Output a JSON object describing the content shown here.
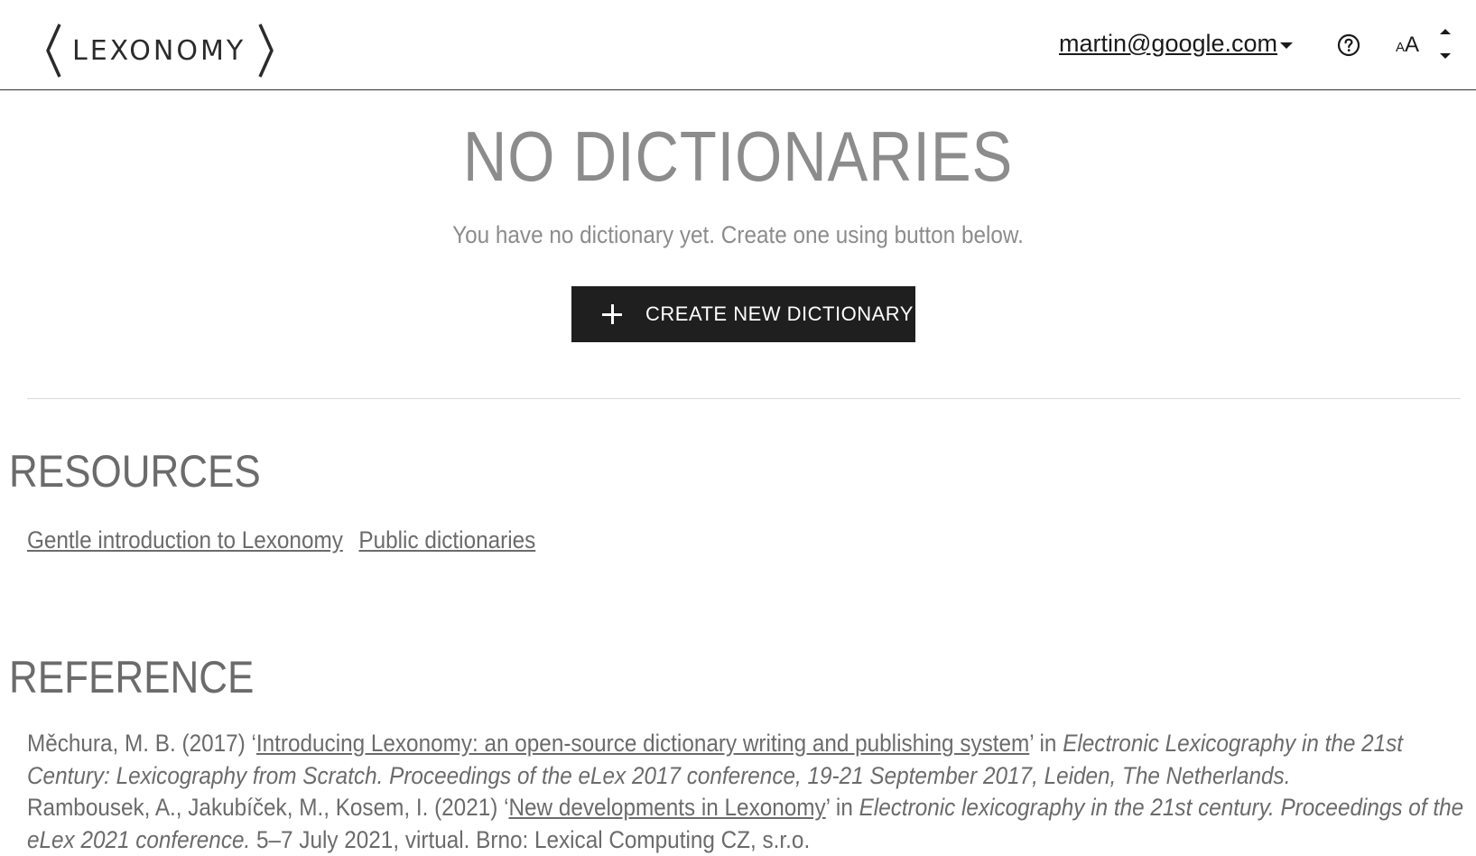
{
  "header": {
    "logo_text": "LEXONOMY",
    "user_email": "martin@google.com",
    "font_size_small": "A",
    "font_size_big": "A"
  },
  "empty_state": {
    "title": "NO DICTIONARIES",
    "subtitle": "You have no dictionary yet. Create one using button below.",
    "create_button_label": "CREATE NEW DICTIONARY"
  },
  "resources": {
    "title": "RESOURCES",
    "links": [
      "Gentle introduction to Lexonomy",
      "Public dictionaries"
    ]
  },
  "reference": {
    "title": "REFERENCE",
    "items": [
      {
        "authors": "Měchura, M. B. (2017) ‘",
        "link": "Introducing Lexonomy: an open-source dictionary writing and publishing system",
        "mid": "’ in ",
        "source": "Electronic Lexicography in the 21st Century: Lexicography from Scratch. Proceedings of the eLex 2017 conference, 19-21 September 2017, Leiden, The Netherlands.",
        "tail": ""
      },
      {
        "authors": "Rambousek, A., Jakubíček, M., Kosem, I. (2021) ‘",
        "link": "New developments in Lexonomy",
        "mid": "’ in ",
        "source": "Electronic lexicography in the 21st century. Proceedings of the eLex 2021 conference.",
        "tail": " 5–7 July 2021, virtual. Brno: Lexical Computing CZ, s.r.o."
      }
    ]
  },
  "icons": {
    "help": "help-circle-icon",
    "caret": "caret-down-icon",
    "plus": "plus-icon"
  },
  "colors": {
    "button_bg": "#1f1f1f",
    "muted_text": "#8c8c8c",
    "body_text": "#6b6b6b"
  }
}
